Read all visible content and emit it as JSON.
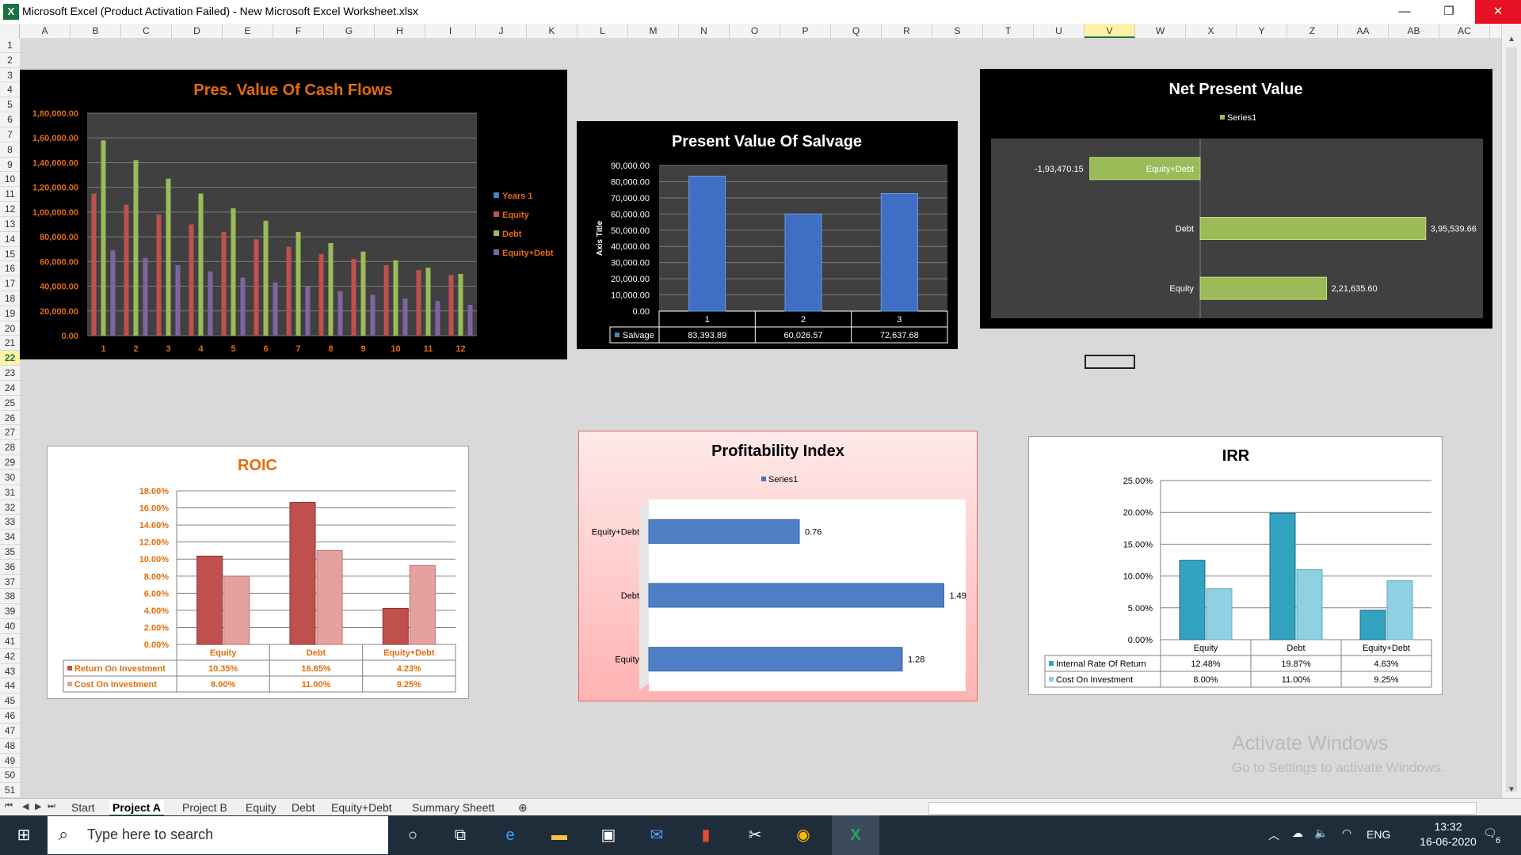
{
  "window": {
    "title": "Microsoft Excel (Product Activation Failed) - New Microsoft Excel Worksheet.xlsx",
    "logo_letter": "X",
    "minimize": "—",
    "restore": "❐",
    "close": "✕"
  },
  "columns": [
    "A",
    "B",
    "C",
    "D",
    "E",
    "F",
    "G",
    "H",
    "I",
    "J",
    "K",
    "L",
    "M",
    "N",
    "O",
    "P",
    "Q",
    "R",
    "S",
    "T",
    "U",
    "V",
    "W",
    "X",
    "Y",
    "Z",
    "AA",
    "AB",
    "AC"
  ],
  "selected_column": "V",
  "rows": [
    "1",
    "2",
    "3",
    "4",
    "5",
    "6",
    "7",
    "8",
    "9",
    "10",
    "11",
    "12",
    "13",
    "14",
    "15",
    "16",
    "17",
    "18",
    "19",
    "20",
    "21",
    "22",
    "23",
    "24",
    "25",
    "26",
    "27",
    "28",
    "29",
    "30",
    "31",
    "32",
    "33",
    "34",
    "35",
    "36",
    "37",
    "38",
    "39",
    "40",
    "41",
    "42",
    "43",
    "44",
    "45",
    "46",
    "47",
    "48",
    "49",
    "50",
    "51"
  ],
  "selected_row": "22",
  "sheet_tabs": [
    "Start",
    "Project A",
    "Project B",
    "Equity",
    "Debt",
    "Equity+Debt",
    "Summary Sheett"
  ],
  "active_tab": "Project A",
  "activate": {
    "line1": "Activate Windows",
    "line2": "Go to Settings to activate Windows."
  },
  "taskbar": {
    "search_placeholder": "Type here to search",
    "language": "ENG",
    "time": "13:32",
    "date": "16-06-2020",
    "notification_count": "6"
  },
  "colors": {
    "excel_green": "#217346",
    "chart_orange": "#e46c0a",
    "bar_blue": "#4472c4",
    "bar_green": "#9bbb59",
    "bar_red": "#c0504d",
    "bar_purple": "#8064a2",
    "bar_teal": "#31849b"
  },
  "chart_data": [
    {
      "type": "bar",
      "title": "Pres. Value Of Cash Flows",
      "categories": [
        "1",
        "2",
        "3",
        "4",
        "5",
        "6",
        "7",
        "8",
        "9",
        "10",
        "11",
        "12"
      ],
      "y_ticks": [
        "1,80,000.00",
        "1,60,000.00",
        "1,40,000.00",
        "1,20,000.00",
        "1,00,000.00",
        "80,000.00",
        "60,000.00",
        "40,000.00",
        "20,000.00",
        "0.00"
      ],
      "ylim": [
        0,
        180000
      ],
      "series": [
        {
          "name": "Years 1",
          "color": "#4f81bd",
          "values": [
            0,
            0,
            0,
            0,
            0,
            0,
            0,
            0,
            0,
            0,
            0,
            0
          ]
        },
        {
          "name": "Equity",
          "color": "#c0504d",
          "values": [
            115000,
            106000,
            98000,
            90000,
            84000,
            78000,
            72000,
            66000,
            62000,
            57000,
            53000,
            49000
          ]
        },
        {
          "name": "Debt",
          "color": "#9bbb59",
          "values": [
            158000,
            142000,
            127000,
            115000,
            103000,
            93000,
            84000,
            75000,
            68000,
            61000,
            55000,
            50000
          ]
        },
        {
          "name": "Equity+Debt",
          "color": "#8064a2",
          "values": [
            69000,
            63000,
            57000,
            52000,
            47000,
            43000,
            40000,
            36000,
            33000,
            30000,
            28000,
            25000
          ]
        }
      ],
      "legend": "right",
      "grid": true
    },
    {
      "type": "bar",
      "title": "Present Value Of Salvage",
      "ylabel": "Axis Title",
      "categories": [
        "1",
        "2",
        "3"
      ],
      "y_ticks": [
        "90,000.00",
        "80,000.00",
        "70,000.00",
        "60,000.00",
        "50,000.00",
        "40,000.00",
        "30,000.00",
        "20,000.00",
        "10,000.00",
        "0.00"
      ],
      "ylim": [
        0,
        90000
      ],
      "series": [
        {
          "name": "Salvage",
          "values": [
            83393.89,
            60026.57,
            72637.68
          ],
          "labels": [
            "83,393.89",
            "60,026.57",
            "72,637.68"
          ]
        }
      ],
      "legend": "data-table",
      "grid": true
    },
    {
      "type": "bar",
      "orientation": "horizontal",
      "title": "Net Present Value",
      "legend_label": "Series1",
      "categories": [
        "Equity+Debt",
        "Debt",
        "Equity"
      ],
      "values": [
        -193470.15,
        395539.66,
        221635.6
      ],
      "labels": [
        "-1,93,470.15",
        "3,95,539.66",
        "2,21,635.60"
      ],
      "legend": "top"
    },
    {
      "type": "bar",
      "title": "ROIC",
      "categories": [
        "Equity",
        "Debt",
        "Equity+Debt"
      ],
      "y_ticks": [
        "18.00%",
        "16.00%",
        "14.00%",
        "12.00%",
        "10.00%",
        "8.00%",
        "6.00%",
        "4.00%",
        "2.00%",
        "0.00%"
      ],
      "ylim": [
        0,
        18
      ],
      "series": [
        {
          "name": "Return On Investment",
          "values": [
            10.35,
            16.65,
            4.23
          ],
          "labels": [
            "10.35%",
            "16.65%",
            "4.23%"
          ]
        },
        {
          "name": "Cost On Investment",
          "values": [
            8.0,
            11.0,
            9.25
          ],
          "labels": [
            "8.00%",
            "11.00%",
            "9.25%"
          ]
        }
      ],
      "legend": "data-table",
      "grid": true
    },
    {
      "type": "bar",
      "orientation": "horizontal",
      "title": "Profitability Index",
      "legend_label": "Series1",
      "categories": [
        "Equity+Debt",
        "Debt",
        "Equity"
      ],
      "values": [
        0.76,
        1.49,
        1.28
      ],
      "labels": [
        "0.76",
        "1.49",
        "1.28"
      ],
      "legend": "top"
    },
    {
      "type": "bar",
      "title": "IRR",
      "categories": [
        "Equity",
        "Debt",
        "Equity+Debt"
      ],
      "y_ticks": [
        "25.00%",
        "20.00%",
        "15.00%",
        "10.00%",
        "5.00%",
        "0.00%"
      ],
      "ylim": [
        0,
        25
      ],
      "series": [
        {
          "name": "Internal Rate Of Return",
          "values": [
            12.48,
            19.87,
            4.63
          ],
          "labels": [
            "12.48%",
            "19.87%",
            "4.63%"
          ]
        },
        {
          "name": "Cost On Investment",
          "values": [
            8.0,
            11.0,
            9.25
          ],
          "labels": [
            "8.00%",
            "11.00%",
            "9.25%"
          ]
        }
      ],
      "legend": "data-table",
      "grid": true
    }
  ]
}
